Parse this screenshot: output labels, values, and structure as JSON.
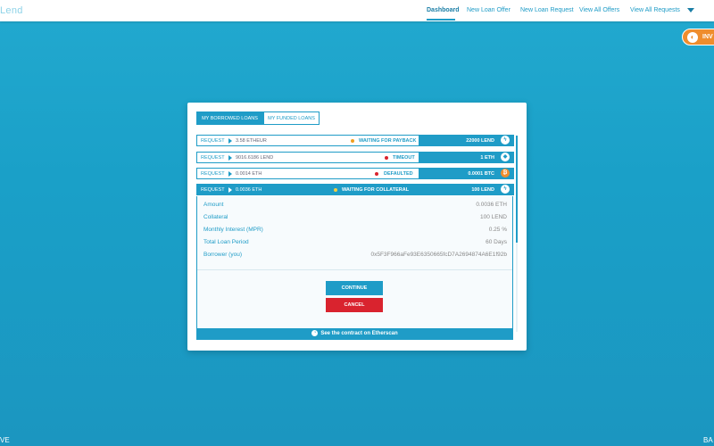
{
  "nav": {
    "brand": "Lend",
    "links": [
      "Dashboard",
      "New Loan Offer",
      "New Loan Request",
      "View All Offers",
      "View All Requests"
    ]
  },
  "invest_pill": {
    "label": "INV"
  },
  "corners": {
    "left": "VE",
    "right": "BA"
  },
  "modal": {
    "tabs": [
      "MY BORROWED LOANS",
      "MY FUNDED LOANS"
    ],
    "rows": [
      {
        "kind": "REQUEST",
        "amount": "3.58 ETHEUR",
        "status": "WAITING FOR PAYBACK",
        "status_color": "#f0a020",
        "value": "22000 LEND",
        "icon": "lend"
      },
      {
        "kind": "REQUEST",
        "amount": "9016.6186 LEND",
        "status": "TIMEOUT",
        "status_color": "#d9232e",
        "value": "1 ETH",
        "icon": "eth"
      },
      {
        "kind": "REQUEST",
        "amount": "0.0014 ETH",
        "status": "DEFAULTED",
        "status_color": "#d9232e",
        "value": "0.0001 BTC",
        "icon": "btc"
      },
      {
        "kind": "REQUEST",
        "amount": "0.0036 ETH",
        "status": "WAITING FOR COLLATERAL",
        "status_color": "#f5d040",
        "value": "100 LEND",
        "icon": "lend"
      }
    ],
    "details": [
      {
        "label": "Amount",
        "value": "0.0036 ETH"
      },
      {
        "label": "Collateral",
        "value": "100 LEND"
      },
      {
        "label": "Monthly Interest (MPR)",
        "value": "0.25 %"
      },
      {
        "label": "Total Loan Period",
        "value": "60 Days"
      },
      {
        "label": "Borrower (you)",
        "value": "0x5F3F966aFe93E6350665fcD7A2694874A6E1f92b"
      }
    ],
    "continue_label": "CONTINUE",
    "cancel_label": "CANCEL",
    "footer": "See the contract on Etherscan"
  }
}
